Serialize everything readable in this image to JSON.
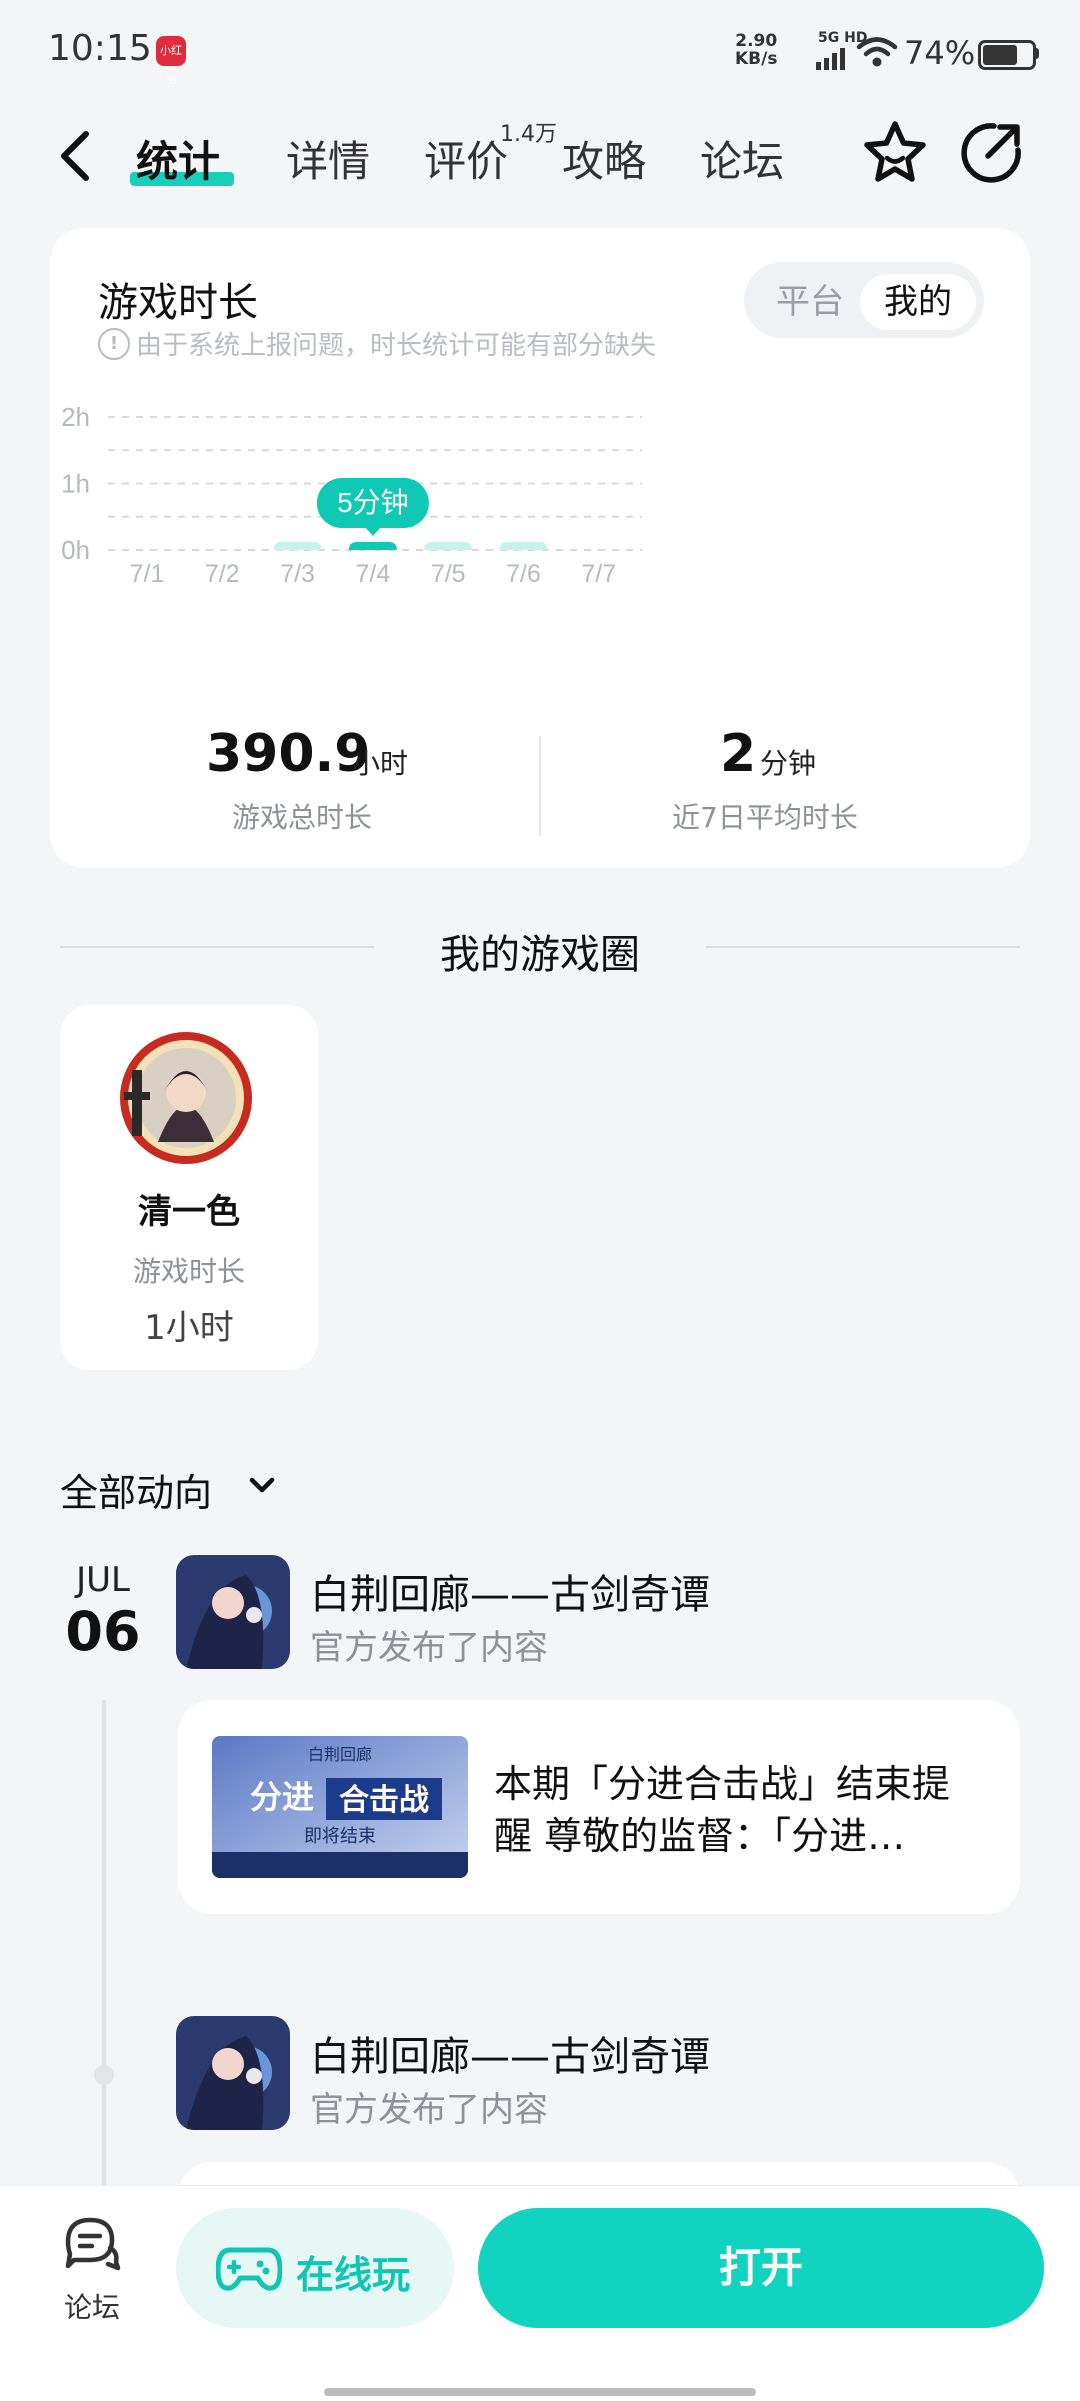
{
  "status_bar": {
    "time": "10:15",
    "badge": "小红书",
    "net_speed_value": "2.90",
    "net_speed_unit": "KB/s",
    "network": "5G HD",
    "battery_pct": "74%",
    "battery_level": 0.74
  },
  "nav": {
    "tabs": [
      {
        "label": "统计",
        "active": true
      },
      {
        "label": "详情"
      },
      {
        "label": "评价",
        "count": "1.4万"
      },
      {
        "label": "攻略"
      },
      {
        "label": "论坛"
      }
    ],
    "icons": [
      "back-icon",
      "star-icon",
      "share-icon"
    ]
  },
  "playtime": {
    "title": "游戏时长",
    "notice": "由于系统上报问题，时长统计可能有部分缺失",
    "toggle": {
      "options": [
        "平台",
        "我的"
      ],
      "selected": "我的"
    },
    "tooltip": "5分钟",
    "total_value": "390.9",
    "total_unit": "小时",
    "total_label": "游戏总时长",
    "avg_value": "2",
    "avg_unit": "分钟",
    "avg_label": "近7日平均时长"
  },
  "chart_data": {
    "type": "bar",
    "categories": [
      "7/1",
      "7/2",
      "7/3",
      "7/4",
      "7/5",
      "7/6",
      "7/7"
    ],
    "values": [
      0,
      0,
      0.01,
      0.083,
      0.01,
      0.01,
      0
    ],
    "highlighted": "7/4",
    "y_ticks": [
      "0h",
      "1h",
      "2h"
    ],
    "ylim": [
      0,
      2
    ],
    "grid": true,
    "colors": {
      "bar": "#c5f2ec",
      "bar_highlight": "#10c9b4"
    }
  },
  "game_circle": {
    "section_title": "我的游戏圈",
    "name": "清一色",
    "sub_label": "游戏时长",
    "value": "1小时"
  },
  "feed": {
    "filter_label": "全部动向",
    "date_month": "JUL",
    "date_day": "06",
    "items": [
      {
        "title": "白荆回廊——古剑奇谭",
        "subtitle": "官方发布了内容",
        "post_text": "本期「分进合击战」结束提醒 尊敬的监督：「分进…",
        "thumb_title_a": "分进",
        "thumb_title_b": "合击战",
        "thumb_sub": "即将结束",
        "thumb_brand": "白荆回廊"
      },
      {
        "title": "白荆回廊——古剑奇谭",
        "subtitle": "官方发布了内容"
      }
    ]
  },
  "bottom_bar": {
    "forum_label": "论坛",
    "online_label": "在线玩",
    "open_label": "打开"
  },
  "colors": {
    "accent": "#10d4bf"
  }
}
